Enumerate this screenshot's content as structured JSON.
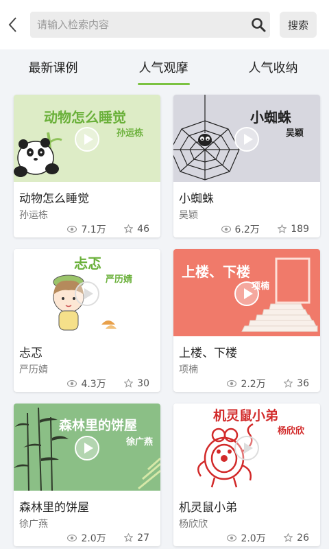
{
  "search": {
    "placeholder": "请输入检索内容",
    "button_label": "搜索"
  },
  "tabs": [
    {
      "label": "最新课例",
      "active": false
    },
    {
      "label": "人气观摩",
      "active": true
    },
    {
      "label": "人气收纳",
      "active": false
    }
  ],
  "colors": {
    "accent": "#7bc241"
  },
  "cards": [
    {
      "title": "动物怎么睡觉",
      "author": "孙运栋",
      "views": "7.1万",
      "favorites": "46"
    },
    {
      "title": "小蜘蛛",
      "author": "吴颖",
      "views": "6.2万",
      "favorites": "189"
    },
    {
      "title": "忐忑",
      "author": "严历婧",
      "views": "4.3万",
      "favorites": "30"
    },
    {
      "title": "上楼、下楼",
      "author": "项楠",
      "views": "2.2万",
      "favorites": "36"
    },
    {
      "title": "森林里的饼屋",
      "author": "徐广燕",
      "views": "2.0万",
      "favorites": "27"
    },
    {
      "title": "机灵鼠小弟",
      "author": "杨欣欣",
      "views": "2.0万",
      "favorites": "26"
    }
  ]
}
